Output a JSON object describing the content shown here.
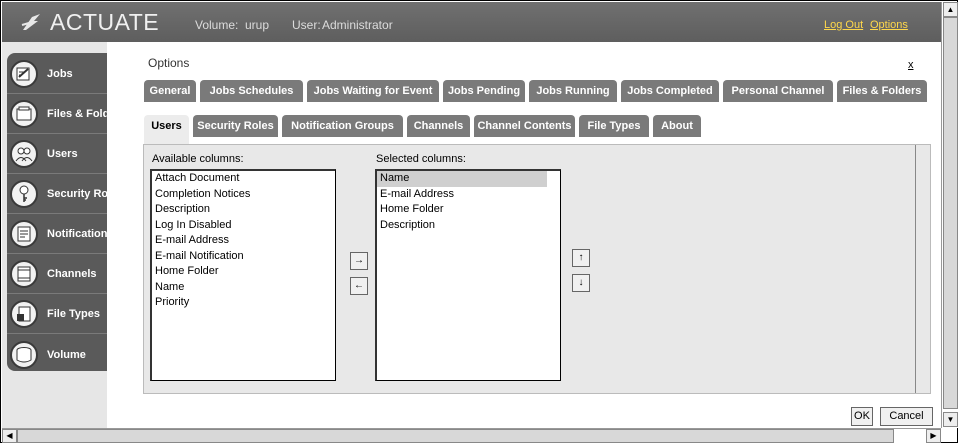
{
  "header": {
    "brand": "ACTUATE",
    "volume_label": "Volume:",
    "volume_value": "urup",
    "user_label": "User:",
    "user_value": "Administrator",
    "logout": "Log Out",
    "options": "Options",
    "accent_color": "#ffd84a"
  },
  "sidebar": {
    "items": [
      {
        "label": "Jobs",
        "icon": "jobs-icon"
      },
      {
        "label": "Files & Folders",
        "icon": "folder-icon"
      },
      {
        "label": "Users",
        "icon": "users-icon"
      },
      {
        "label": "Security Roles",
        "icon": "key-icon"
      },
      {
        "label": "Notification Groups",
        "icon": "notification-icon"
      },
      {
        "label": "Channels",
        "icon": "channels-icon"
      },
      {
        "label": "File Types",
        "icon": "file-types-icon"
      },
      {
        "label": "Volume",
        "icon": "volume-icon"
      }
    ]
  },
  "main": {
    "title": "Options",
    "close": "x",
    "tabs_row1": [
      "General",
      "Jobs Schedules",
      "Jobs Waiting for Event",
      "Jobs Pending",
      "Jobs Running",
      "Jobs Completed",
      "Personal Channel",
      "Files & Folders"
    ],
    "tabs_row2": [
      "Users",
      "Security Roles",
      "Notification Groups",
      "Channels",
      "Channel Contents",
      "File Types",
      "About"
    ],
    "active_tab": "Users",
    "available_label": "Available columns:",
    "selected_label": "Selected columns:",
    "available_columns": [
      "Attach Document",
      "Completion Notices",
      "Description",
      "Log In Disabled",
      "E-mail Address",
      "E-mail Notification",
      "Home Folder",
      "Name",
      "Priority"
    ],
    "selected_columns": [
      "Name",
      "E-mail Address",
      "Home Folder",
      "Description"
    ],
    "selected_highlight": "Name",
    "add_arrow": "→",
    "remove_arrow": "←",
    "up_arrow": "↑",
    "down_arrow": "↓",
    "ok": "OK",
    "cancel": "Cancel"
  }
}
